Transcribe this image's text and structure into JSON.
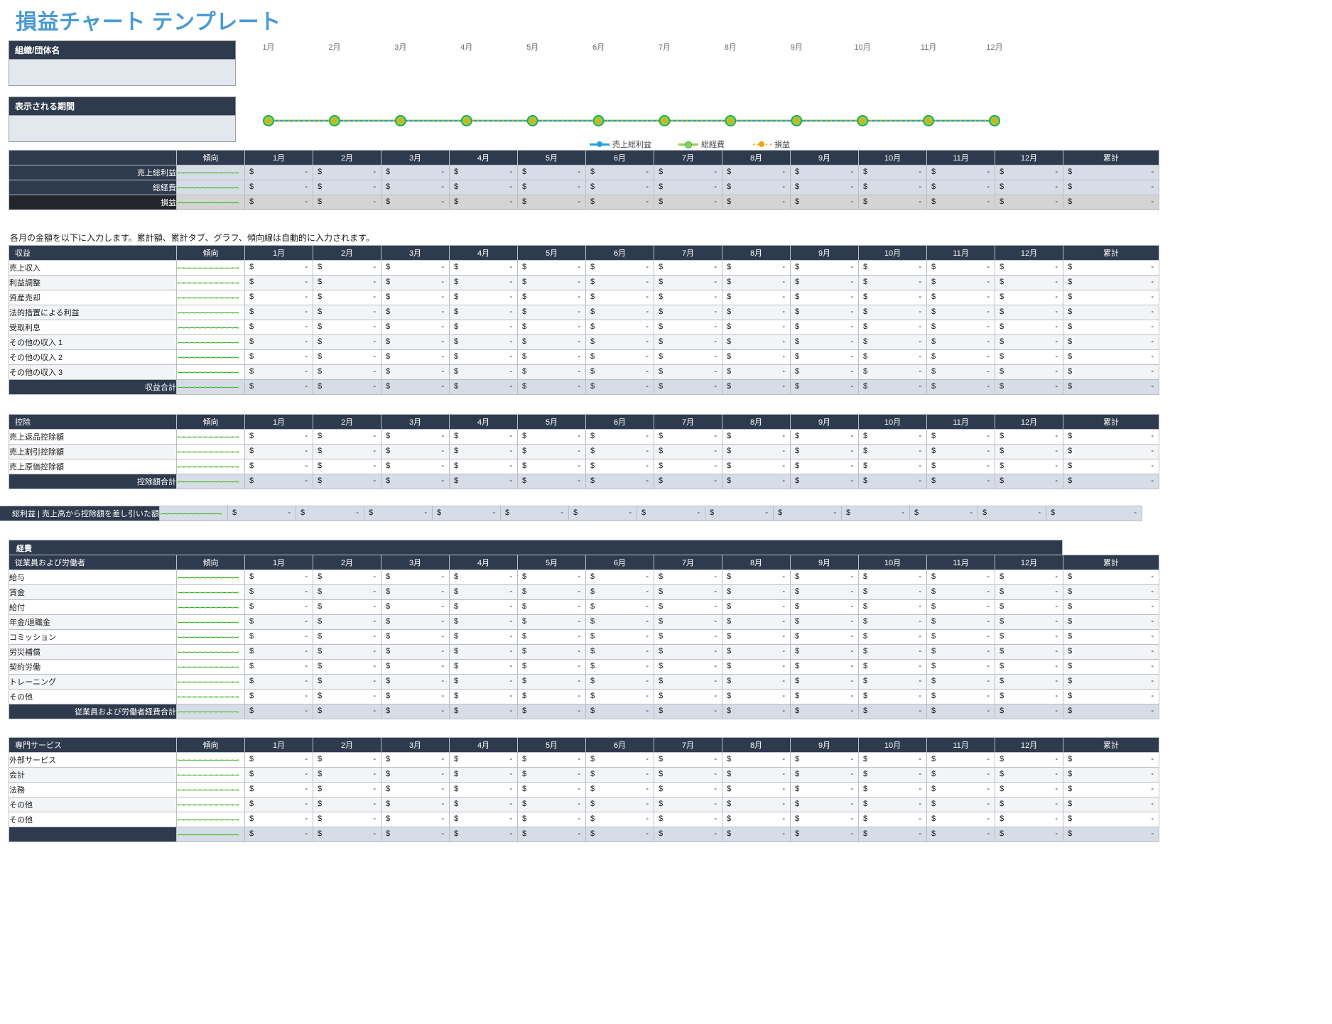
{
  "title": "損益チャート テンプレート",
  "info": {
    "org_label": "組織/団体名",
    "org_value": "",
    "period_label": "表示される期間",
    "period_value": ""
  },
  "chart": {
    "months": [
      "1月",
      "2月",
      "3月",
      "4月",
      "5月",
      "6月",
      "7月",
      "8月",
      "9月",
      "10月",
      "11月",
      "12月"
    ],
    "legend": [
      {
        "label": "売上総利益",
        "color": "#24a3dc",
        "style": "solid"
      },
      {
        "label": "総経費",
        "color": "#8fd14f",
        "style": "solid"
      },
      {
        "label": "損益",
        "color": "#f0a30a",
        "style": "dotted"
      }
    ]
  },
  "columns": {
    "trend": "傾向",
    "months": [
      "1月",
      "2月",
      "3月",
      "4月",
      "5月",
      "6月",
      "7月",
      "8月",
      "9月",
      "10月",
      "11月",
      "12月"
    ],
    "total": "累計"
  },
  "cell": {
    "currency": "$",
    "value": "-"
  },
  "summary": {
    "rows": [
      {
        "label": "売上総利益"
      },
      {
        "label": "総経費"
      },
      {
        "label": "損益"
      }
    ]
  },
  "note": "各月の金額を以下に入力します。累計額、累計タブ、グラフ、傾向線は自動的に入力されます。",
  "revenue": {
    "header": "収益",
    "rows": [
      {
        "label": "売上収入"
      },
      {
        "label": "利益調整"
      },
      {
        "label": "資産売却"
      },
      {
        "label": "法的措置による利益"
      },
      {
        "label": "受取利息"
      },
      {
        "label": "その他の収入 1"
      },
      {
        "label": "その他の収入 2"
      },
      {
        "label": "その他の収入 3"
      }
    ],
    "total_label": "収益合計"
  },
  "deductions": {
    "header": "控除",
    "rows": [
      {
        "label": "売上返品控除額"
      },
      {
        "label": "売上割引控除額"
      },
      {
        "label": "売上原価控除額"
      }
    ],
    "total_label": "控除額合計"
  },
  "gross_profit": {
    "label": "総利益 | 売上高から控除額を差し引いた額"
  },
  "expenses": {
    "band": "経費",
    "employees": {
      "header": "従業員および労働者",
      "rows": [
        {
          "label": "給与"
        },
        {
          "label": "賃金"
        },
        {
          "label": "給付"
        },
        {
          "label": "年金/退職金"
        },
        {
          "label": "コミッション"
        },
        {
          "label": "労災補償"
        },
        {
          "label": "契約労働"
        },
        {
          "label": "トレーニング"
        },
        {
          "label": "その他"
        }
      ],
      "total_label": "従業員および労働者経費合計"
    },
    "professional": {
      "header": "専門サービス",
      "rows": [
        {
          "label": "外部サービス"
        },
        {
          "label": "会計"
        },
        {
          "label": "法務"
        },
        {
          "label": "その他"
        },
        {
          "label": "その他"
        }
      ],
      "total_label": ""
    }
  },
  "colors": {
    "header_navy": "#2e3a4d",
    "accent_blue": "#4a9ad4",
    "field_blue": "#e3e7ee",
    "money_blue": "#d7dde7",
    "spark_green": "#2aa84a",
    "spark_node": "#8fd14f"
  }
}
